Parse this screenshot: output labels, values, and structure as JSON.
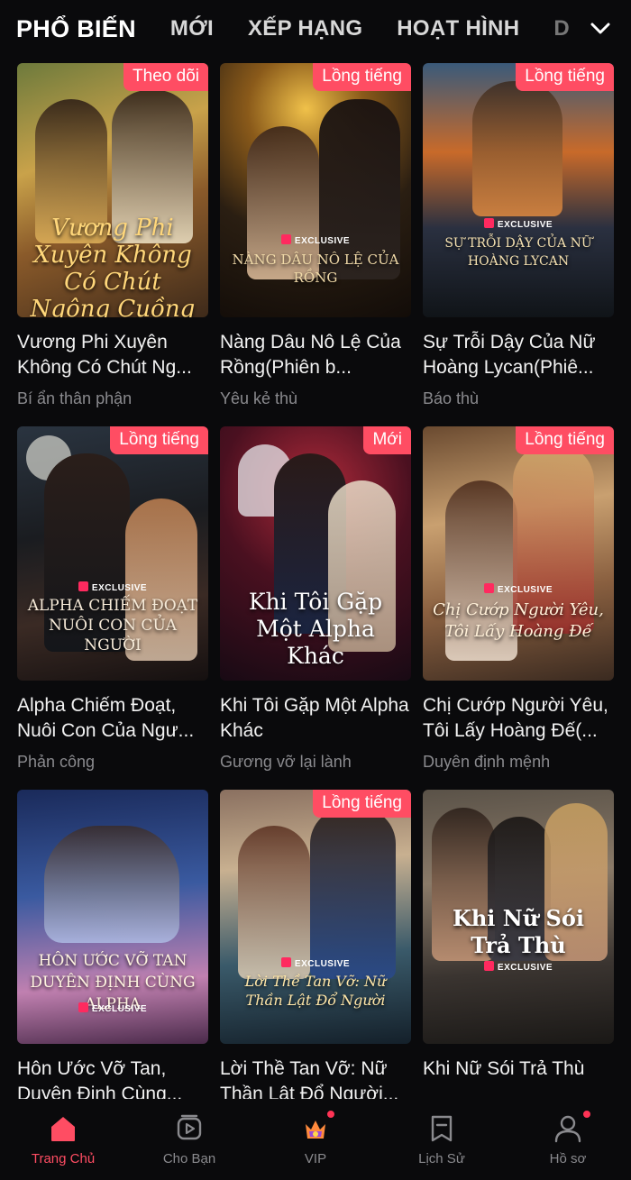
{
  "tabs": [
    {
      "label": "PHỔ BIẾN"
    },
    {
      "label": "MỚI"
    },
    {
      "label": "XẾP HẠNG"
    },
    {
      "label": "HOẠT HÌNH"
    },
    {
      "label": "D"
    }
  ],
  "exclusive_label": "EXCLUSIVE",
  "cards": [
    {
      "badge": "Theo dõi",
      "title": "Vương Phi Xuyên Không Có Chút Ng...",
      "genre": "Bí ẩn thân phận",
      "cover_title": "Vương Phi Xuyên Không Có Chút Ngông Cuồng"
    },
    {
      "badge": "Lồng tiếng",
      "title": "Nàng Dâu Nô Lệ Của Rồng(Phiên b...",
      "genre": "Yêu kẻ thù",
      "cover_title": "NÀNG DÂU NÔ LỆ CỦA RỒNG"
    },
    {
      "badge": "Lồng tiếng",
      "title": "Sự Trỗi Dậy Của Nữ Hoàng Lycan(Phiê...",
      "genre": "Báo thù",
      "cover_title": "SỰ TRỖI DẬY CỦA NỮ HOÀNG LYCAN"
    },
    {
      "badge": "Lồng tiếng",
      "title": "Alpha Chiếm Đoạt, Nuôi Con Của Ngư...",
      "genre": "Phản công",
      "cover_title": "ALPHA CHIẾM ĐOẠT NUÔI CON CỦA NGƯỜI"
    },
    {
      "badge": "Mới",
      "title": "Khi Tôi Gặp Một Alpha Khác",
      "genre": "Gương vỡ lại lành",
      "cover_title": "Khi Tôi Gặp Một Alpha Khác"
    },
    {
      "badge": "Lồng tiếng",
      "title": "Chị Cướp Người Yêu, Tôi Lấy Hoàng Đế(...",
      "genre": "Duyên định mệnh",
      "cover_title": "Chị Cướp Người Yêu, Tôi Lấy Hoàng Đế"
    },
    {
      "badge": "",
      "title": "Hôn Ước Vỡ Tan, Duyên Định Cùng...",
      "genre": "",
      "cover_title": "HÔN ƯỚC VỠ TAN DUYÊN ĐỊNH CÙNG ALPHA"
    },
    {
      "badge": "Lồng tiếng",
      "title": "Lời Thề Tan Vỡ: Nữ Thần Lật Đổ Người...",
      "genre": "",
      "cover_title": "Lời Thề Tan Vỡ: Nữ Thần Lật Đổ Người"
    },
    {
      "badge": "",
      "title": "Khi Nữ Sói Trả Thù",
      "genre": "",
      "cover_title": "Khi Nữ Sói Trả Thù"
    }
  ],
  "bottom_nav": [
    {
      "label": "Trang Chủ",
      "icon": "home-icon",
      "active": true
    },
    {
      "label": "Cho Bạn",
      "icon": "play-stack-icon"
    },
    {
      "label": "VIP",
      "icon": "vip-crown-icon"
    },
    {
      "label": "Lịch Sử",
      "icon": "bookmark-icon"
    },
    {
      "label": "Hồ sơ",
      "icon": "profile-icon"
    }
  ],
  "colors": {
    "accent": "#ff4d63",
    "background": "#0a0a0c",
    "secondary_text": "#8a8a8e"
  }
}
